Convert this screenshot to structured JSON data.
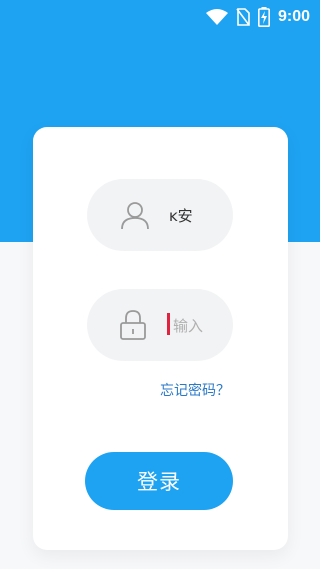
{
  "status_bar": {
    "time": "9:00",
    "icons": [
      "wifi-icon",
      "no-sim-icon",
      "battery-charging-icon"
    ]
  },
  "login_form": {
    "username": {
      "icon": "user-icon",
      "value": "ĸ安"
    },
    "password": {
      "icon": "lock-icon",
      "placeholder": "输入"
    },
    "forgot_password_label": "忘记密码？",
    "login_button_label": "登录"
  },
  "colors": {
    "accent": "#1ea3f2",
    "link": "#2979c8",
    "field_bg": "#f2f3f5",
    "page_bg": "#f7f8fa"
  }
}
